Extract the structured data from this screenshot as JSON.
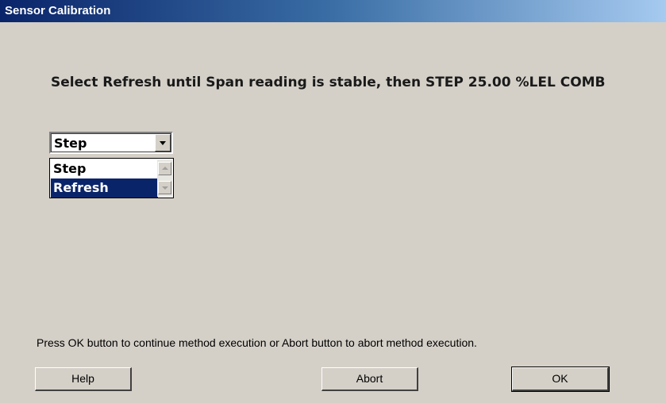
{
  "window": {
    "title": "Sensor Calibration"
  },
  "instruction": {
    "text": "Select Refresh until Span reading is stable, then STEP 25.00 %LEL COMB"
  },
  "combo": {
    "selected_value": "Step",
    "options": [
      "Step",
      "Refresh"
    ],
    "highlighted_option": "Refresh"
  },
  "footer": {
    "message": "Press OK button to continue method execution or Abort button to abort method execution."
  },
  "buttons": {
    "help_label": "Help",
    "abort_label": "Abort",
    "ok_label": "OK"
  },
  "colors": {
    "dialog_background": "#d4d0c8",
    "title_gradient_start": "#0a246a",
    "title_gradient_end": "#a6caf0",
    "selection": "#0a246a"
  },
  "icons": {
    "combo_dropdown": "chevron-down-icon",
    "scroll_up": "scroll-up-icon",
    "scroll_down": "scroll-down-icon"
  }
}
